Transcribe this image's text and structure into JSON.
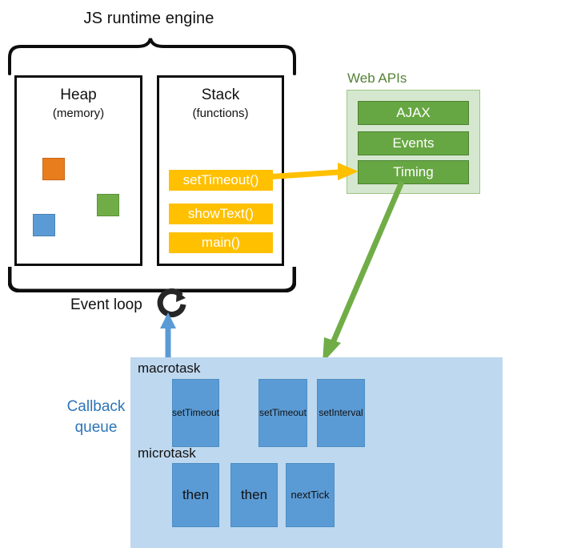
{
  "diagram": {
    "title": "JS runtime engine",
    "engine": {
      "heap": {
        "title": "Heap",
        "subtitle": "(memory)"
      },
      "stack": {
        "title": "Stack",
        "subtitle": "(functions)"
      },
      "heap_blobs": [
        {
          "name": "orange-object",
          "color": "#E87D1E"
        },
        {
          "name": "green-object",
          "color": "#70AD47"
        },
        {
          "name": "blue-object",
          "color": "#5B9BD5"
        }
      ],
      "stack_frames": [
        {
          "label": "setTimeout()",
          "color": "#FFC000"
        },
        {
          "label": "showText()",
          "color": "#FFC000"
        },
        {
          "label": "main()",
          "color": "#FFC000"
        }
      ]
    },
    "web_apis": {
      "title": "Web APIs",
      "panel_color": "#D5E8CF",
      "item_color": "#67A743",
      "items": [
        {
          "label": "AJAX"
        },
        {
          "label": "Events"
        },
        {
          "label": "Timing"
        }
      ]
    },
    "event_loop": {
      "label": "Event loop",
      "icon": "circular-arrow-icon"
    },
    "callback_queue": {
      "label": "Callback queue",
      "label_line1": "Callback",
      "label_line2": "queue",
      "panel_color": "#BED8EF",
      "label_color": "#2E75B6",
      "macrotask": {
        "label": "macrotask",
        "items": [
          {
            "label": "setTimeout"
          },
          {
            "label": "setTimeout"
          },
          {
            "label": "setInterval"
          }
        ]
      },
      "microtask": {
        "label": "microtask",
        "items": [
          {
            "label": "then"
          },
          {
            "label": "then"
          },
          {
            "label": "nextTick"
          }
        ]
      }
    },
    "arrows": [
      {
        "name": "stack-to-webapi-arrow",
        "color": "#FFC000",
        "from": "setTimeout() stack frame",
        "to": "Timing"
      },
      {
        "name": "webapi-to-queue-arrow",
        "color": "#70AD47",
        "from": "Timing",
        "to": "macrotask queue"
      },
      {
        "name": "queue-to-eventloop-arrow",
        "color": "#5B9BD5",
        "from": "callback queue",
        "to": "Event loop"
      }
    ]
  }
}
